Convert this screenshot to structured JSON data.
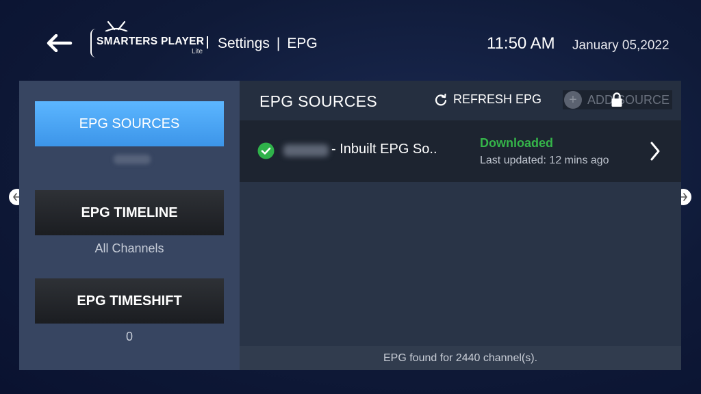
{
  "header": {
    "logo_text": "SMARTERS PLAYER",
    "logo_sub": "Lite",
    "crumb_section": "Settings",
    "crumb_separator": "|",
    "crumb_page": "EPG",
    "time": "11:50 AM",
    "date": "January 05,2022"
  },
  "sidebar": {
    "items": [
      {
        "label": "EPG SOURCES",
        "sub": ""
      },
      {
        "label": "EPG TIMELINE",
        "sub": "All Channels"
      },
      {
        "label": "EPG TIMESHIFT",
        "sub": "0"
      }
    ]
  },
  "content": {
    "title": "EPG SOURCES",
    "refresh_label": "REFRESH EPG",
    "add_label": "ADD SOURCE",
    "sources": [
      {
        "name": "- Inbuilt EPG So..",
        "status": "Downloaded",
        "updated": "Last updated: 12 mins ago"
      }
    ],
    "footer": "EPG found for 2440 channel(s)."
  },
  "colors": {
    "accent_blue": "#4aa6f5",
    "status_green": "#35b54a",
    "check_green": "#2fb24a"
  }
}
